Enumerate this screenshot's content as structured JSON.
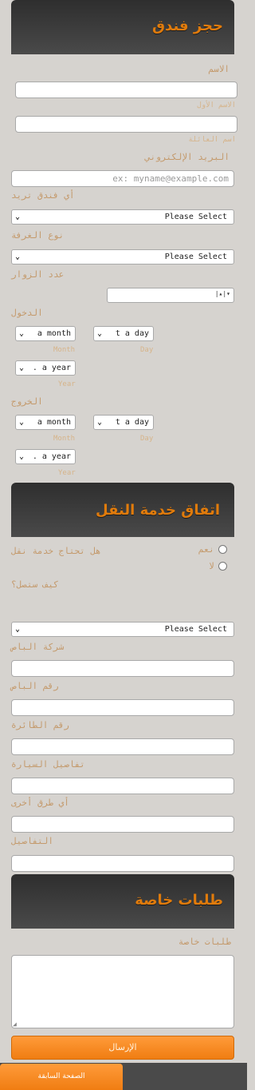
{
  "section1": {
    "title": "حجز فندق",
    "name_label": "الاسم",
    "first_name_sub": "الاسم الأول",
    "last_name_sub": "اسم العائلة",
    "email_label": "البريد الإلكتروني",
    "email_placeholder": "ex: myname@example.com",
    "hotel_label": "أي فندق تريد",
    "hotel_value": "Please Select",
    "room_label": "نوع الغرفة",
    "room_value": "Please Select",
    "guests_label": "عدد الزوار",
    "checkin_label": "الدخول",
    "checkout_label": "الخروج",
    "month_value": "a month",
    "day_value": "t a day",
    "year_value": ". a year",
    "month_sub": "Month",
    "day_sub": "Day",
    "year_sub": "Year"
  },
  "section2": {
    "title": "اتفاق خدمة النقل",
    "need_label": "هل تحتاج خدمة نقل",
    "yes_label": "نعم",
    "no_label": "لا",
    "how_label": "كيف ستصل؟",
    "how_value": "Please Select",
    "bus_company_label": "شركة الباص",
    "bus_number_label": "رقم الباص",
    "flight_number_label": "رقم الطائرة",
    "car_details_label": "تفاصيل السيارة",
    "other_label": "أي طرق أخرى",
    "details_label": "التفاصيل"
  },
  "section3": {
    "title": "طلبات خاصة",
    "requests_label": "طلبات خاصة"
  },
  "buttons": {
    "submit": "الإرسال",
    "previous": "الصفحة السابقة"
  },
  "colors": {
    "accent": "#f07d12",
    "header_bg": "#3a3a3a",
    "label": "#c49a6c",
    "page_bg": "#d6d3cf"
  }
}
